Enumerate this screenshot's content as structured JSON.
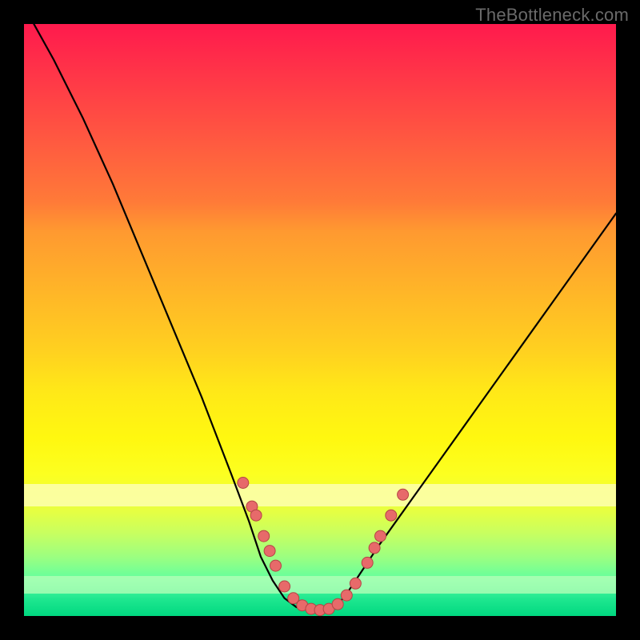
{
  "watermark": "TheBottleneck.com",
  "colors": {
    "curve": "#000000",
    "marker_fill": "#e76a6a",
    "marker_stroke": "#b54545"
  },
  "chart_data": {
    "type": "line",
    "title": "",
    "xlabel": "",
    "ylabel": "",
    "xlim": [
      0,
      1
    ],
    "ylim": [
      0,
      1
    ],
    "series": [
      {
        "name": "bottleneck-curve",
        "x": [
          0.0,
          0.05,
          0.1,
          0.15,
          0.2,
          0.25,
          0.3,
          0.35,
          0.38,
          0.4,
          0.42,
          0.44,
          0.46,
          0.48,
          0.5,
          0.52,
          0.54,
          0.56,
          0.6,
          0.65,
          0.7,
          0.75,
          0.8,
          0.85,
          0.9,
          0.95,
          1.0
        ],
        "y": [
          1.03,
          0.94,
          0.84,
          0.73,
          0.61,
          0.49,
          0.37,
          0.24,
          0.16,
          0.1,
          0.06,
          0.03,
          0.015,
          0.01,
          0.01,
          0.015,
          0.03,
          0.06,
          0.12,
          0.19,
          0.26,
          0.33,
          0.4,
          0.47,
          0.54,
          0.61,
          0.68
        ]
      }
    ],
    "markers": {
      "name": "highlight-dots",
      "x": [
        0.37,
        0.385,
        0.392,
        0.405,
        0.415,
        0.425,
        0.44,
        0.455,
        0.47,
        0.485,
        0.5,
        0.515,
        0.53,
        0.545,
        0.56,
        0.58,
        0.592,
        0.602,
        0.62,
        0.64
      ],
      "y": [
        0.225,
        0.185,
        0.17,
        0.135,
        0.11,
        0.085,
        0.05,
        0.03,
        0.018,
        0.012,
        0.01,
        0.012,
        0.02,
        0.035,
        0.055,
        0.09,
        0.115,
        0.135,
        0.17,
        0.205
      ]
    }
  }
}
